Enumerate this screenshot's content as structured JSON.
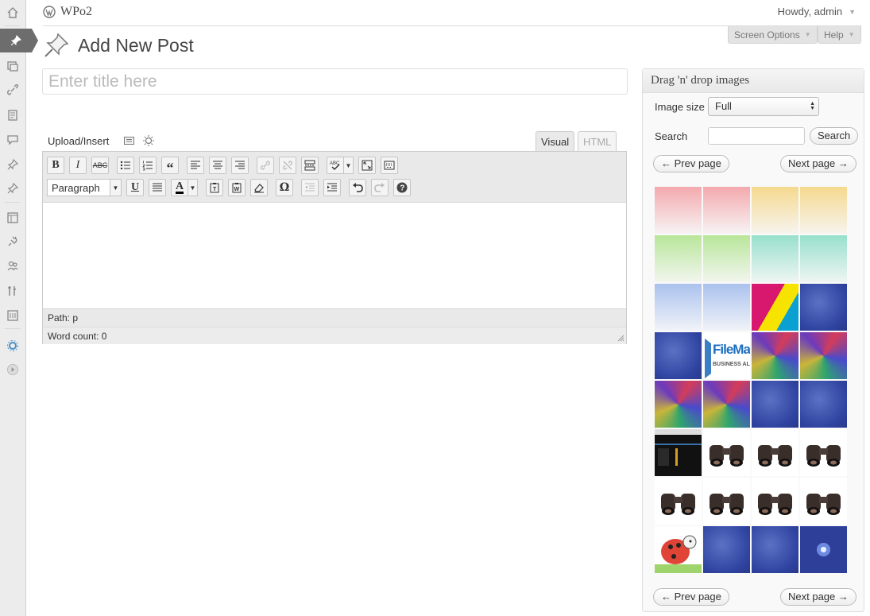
{
  "site": {
    "title": "WPo2"
  },
  "user": {
    "greeting": "Howdy, admin"
  },
  "header": {
    "screen_options": "Screen Options",
    "help": "Help"
  },
  "page": {
    "title": "Add New Post"
  },
  "post": {
    "title_placeholder": "Enter title here"
  },
  "media": {
    "upload_insert": "Upload/Insert"
  },
  "editor": {
    "tab_visual": "Visual",
    "tab_html": "HTML",
    "format_select": "Paragraph",
    "path": "Path: p",
    "word_count": "Word count: 0"
  },
  "toolbar_row1": [
    "bold",
    "italic",
    "strikethrough",
    "bullet-list",
    "numbered-list",
    "blockquote",
    "align-left",
    "align-center",
    "align-right",
    "link",
    "unlink",
    "more",
    "spellcheck",
    "fullscreen",
    "kitchen-sink"
  ],
  "toolbar_row2": [
    "underline",
    "justify",
    "text-color",
    "paste-text",
    "paste-word",
    "remove-format",
    "special-char",
    "outdent",
    "indent",
    "undo",
    "redo",
    "help"
  ],
  "widget": {
    "title": "Drag 'n' drop images",
    "image_size_label": "Image size",
    "image_size_value": "Full",
    "search_label": "Search",
    "search_button": "Search",
    "prev_page": "← Prev page",
    "next_page": "Next page →",
    "thumb_logo_text": "FileMake",
    "thumb_logo_sub": "BUSINESS ALLIAN",
    "thumbnails": [
      "pink-gradient",
      "pink-gradient",
      "yellow-gradient",
      "yellow-gradient",
      "green-gradient",
      "green-gradient",
      "teal-gradient",
      "teal-gradient",
      "blue-gradient",
      "blue-gradient",
      "tricolor-abstract",
      "blue-texture",
      "blue-texture",
      "filemaker-logo",
      "rainbow-noise",
      "rainbow-noise",
      "rainbow-noise",
      "rainbow-noise",
      "blue-texture",
      "blue-texture",
      "dark-screenshot",
      "binoculars",
      "binoculars",
      "binoculars",
      "binoculars",
      "binoculars",
      "binoculars",
      "binoculars",
      "ladybug-cartoon",
      "blue-texture",
      "blue-texture",
      "snowflake-pattern"
    ]
  },
  "colors": {
    "menu_current": "#6d6d6d",
    "menu_bg": "#ececec",
    "link": "#21759b"
  }
}
